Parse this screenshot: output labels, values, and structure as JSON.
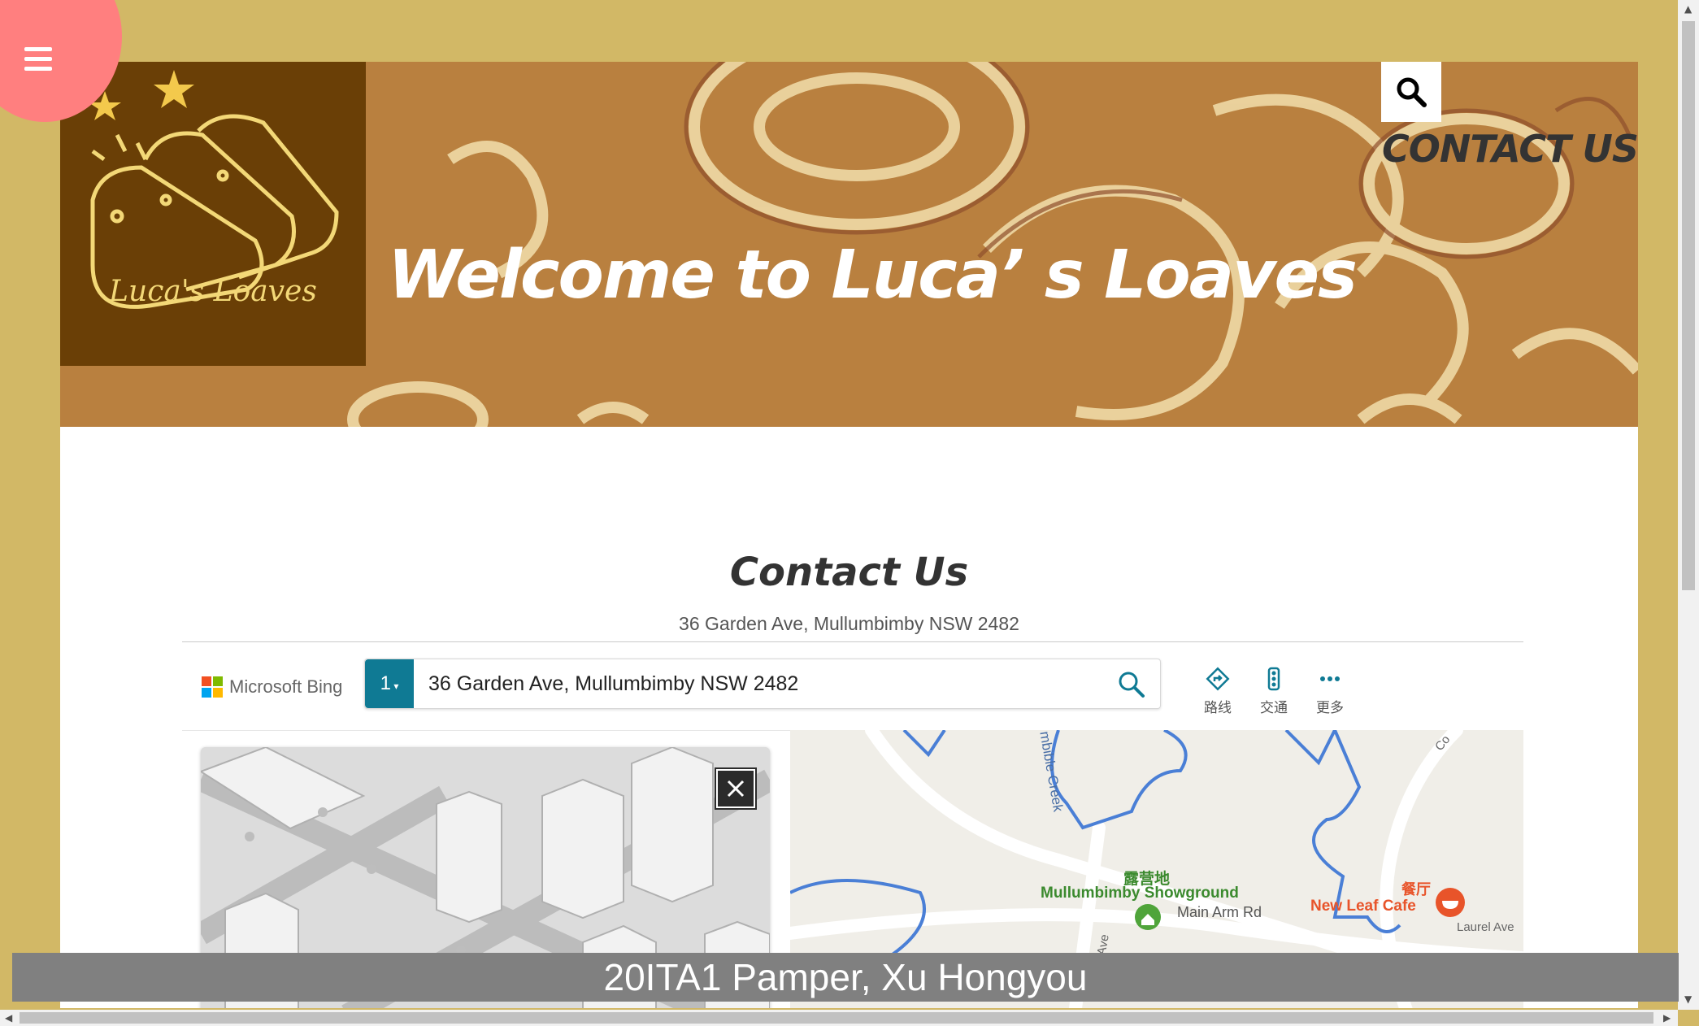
{
  "site": {
    "logo_text": "Luca's Loaves",
    "hero_title": "Welcome to Luca’ s Loaves",
    "nav_contact": "CONTACT US",
    "menu_icon": "hamburger-icon",
    "search_icon": "search-icon"
  },
  "contact": {
    "title": "Contact Us",
    "address": "36 Garden Ave, Mullumbimby NSW 2482"
  },
  "map": {
    "brand": "Microsoft Bing",
    "pin_number": "1",
    "search_value": "36 Garden Ave, Mullumbimby NSW 2482",
    "tools": [
      {
        "label": "路线",
        "icon": "directions-icon"
      },
      {
        "label": "交通",
        "icon": "traffic-icon"
      },
      {
        "label": "更多",
        "icon": "more-icon"
      }
    ],
    "labels": {
      "creek": "mbible Creek",
      "showground_cn": "露营地",
      "showground_en": "Mullumbimby Showground",
      "main_arm": "Main Arm Rd",
      "cafe_cn": "餐厅",
      "cafe_en": "New Leaf Cafe",
      "laurel": "Laurel Ave",
      "ave": "le Ave",
      "co": "Co"
    },
    "colors": {
      "water": "#4a7fd6",
      "park": "#4fa43a",
      "poi": "#e8542a",
      "accent": "#0f7a94"
    }
  },
  "footer": {
    "caption": "20ITA1 Pamper, Xu Hongyou"
  },
  "colors": {
    "page_bg": "#d2b866",
    "hero_bg": "#b9803f",
    "logo_bg": "#6a3f06",
    "menu_blob": "#ff7f7f"
  }
}
